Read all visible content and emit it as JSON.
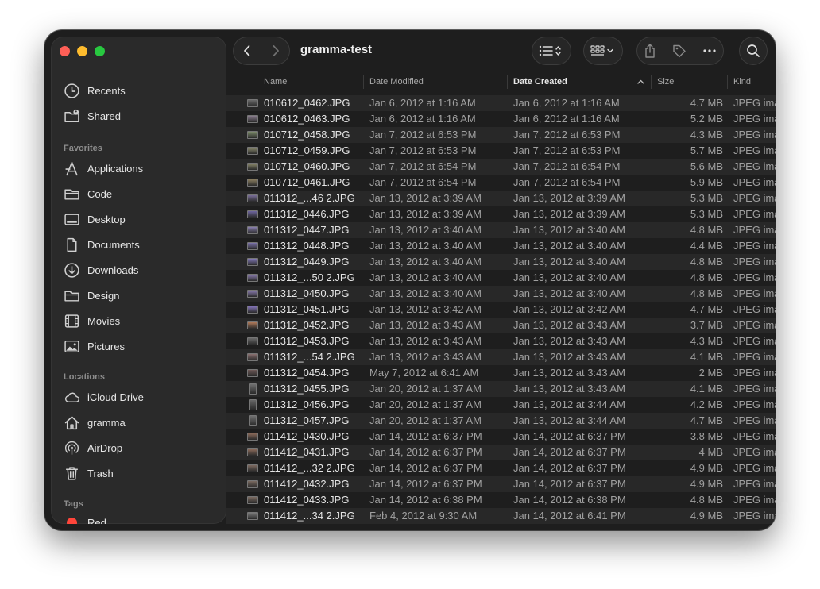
{
  "window": {
    "title": "gramma-test"
  },
  "sidebar": {
    "top_items": [
      {
        "label": "Recents",
        "icon": "clock-icon"
      },
      {
        "label": "Shared",
        "icon": "shared-folder-icon"
      }
    ],
    "favorites_header": "Favorites",
    "favorites": [
      {
        "label": "Applications",
        "icon": "applications-icon"
      },
      {
        "label": "Code",
        "icon": "folder-icon"
      },
      {
        "label": "Desktop",
        "icon": "desktop-icon"
      },
      {
        "label": "Documents",
        "icon": "document-icon"
      },
      {
        "label": "Downloads",
        "icon": "download-icon"
      },
      {
        "label": "Design",
        "icon": "folder-icon"
      },
      {
        "label": "Movies",
        "icon": "film-icon"
      },
      {
        "label": "Pictures",
        "icon": "photo-icon"
      }
    ],
    "locations_header": "Locations",
    "locations": [
      {
        "label": "iCloud Drive",
        "icon": "cloud-icon"
      },
      {
        "label": "gramma",
        "icon": "home-icon"
      },
      {
        "label": "AirDrop",
        "icon": "airdrop-icon"
      },
      {
        "label": "Trash",
        "icon": "trash-icon"
      }
    ],
    "tags_header": "Tags",
    "tags": [
      {
        "label": "Red",
        "color": "#ff453a"
      }
    ]
  },
  "columns": {
    "name": "Name",
    "date_modified": "Date Modified",
    "date_created": "Date Created",
    "size": "Size",
    "kind": "Kind",
    "sorted_by": "Date Created",
    "sort_direction": "ascending"
  },
  "files": [
    {
      "name": "010612_0462.JPG",
      "modified": "Jan 6, 2012 at 1:16 AM",
      "created": "Jan 6, 2012 at 1:16 AM",
      "size": "4.7 MB",
      "kind": "JPEG image"
    },
    {
      "name": "010612_0463.JPG",
      "modified": "Jan 6, 2012 at 1:16 AM",
      "created": "Jan 6, 2012 at 1:16 AM",
      "size": "5.2 MB",
      "kind": "JPEG image"
    },
    {
      "name": "010712_0458.JPG",
      "modified": "Jan 7, 2012 at 6:53 PM",
      "created": "Jan 7, 2012 at 6:53 PM",
      "size": "4.3 MB",
      "kind": "JPEG image"
    },
    {
      "name": "010712_0459.JPG",
      "modified": "Jan 7, 2012 at 6:53 PM",
      "created": "Jan 7, 2012 at 6:53 PM",
      "size": "5.7 MB",
      "kind": "JPEG image"
    },
    {
      "name": "010712_0460.JPG",
      "modified": "Jan 7, 2012 at 6:54 PM",
      "created": "Jan 7, 2012 at 6:54 PM",
      "size": "5.6 MB",
      "kind": "JPEG image"
    },
    {
      "name": "010712_0461.JPG",
      "modified": "Jan 7, 2012 at 6:54 PM",
      "created": "Jan 7, 2012 at 6:54 PM",
      "size": "5.9 MB",
      "kind": "JPEG image"
    },
    {
      "name": "011312_...46 2.JPG",
      "modified": "Jan 13, 2012 at 3:39 AM",
      "created": "Jan 13, 2012 at 3:39 AM",
      "size": "5.3 MB",
      "kind": "JPEG image"
    },
    {
      "name": "011312_0446.JPG",
      "modified": "Jan 13, 2012 at 3:39 AM",
      "created": "Jan 13, 2012 at 3:39 AM",
      "size": "5.3 MB",
      "kind": "JPEG image"
    },
    {
      "name": "011312_0447.JPG",
      "modified": "Jan 13, 2012 at 3:40 AM",
      "created": "Jan 13, 2012 at 3:40 AM",
      "size": "4.8 MB",
      "kind": "JPEG image"
    },
    {
      "name": "011312_0448.JPG",
      "modified": "Jan 13, 2012 at 3:40 AM",
      "created": "Jan 13, 2012 at 3:40 AM",
      "size": "4.4 MB",
      "kind": "JPEG image"
    },
    {
      "name": "011312_0449.JPG",
      "modified": "Jan 13, 2012 at 3:40 AM",
      "created": "Jan 13, 2012 at 3:40 AM",
      "size": "4.8 MB",
      "kind": "JPEG image"
    },
    {
      "name": "011312_...50 2.JPG",
      "modified": "Jan 13, 2012 at 3:40 AM",
      "created": "Jan 13, 2012 at 3:40 AM",
      "size": "4.8 MB",
      "kind": "JPEG image"
    },
    {
      "name": "011312_0450.JPG",
      "modified": "Jan 13, 2012 at 3:40 AM",
      "created": "Jan 13, 2012 at 3:40 AM",
      "size": "4.8 MB",
      "kind": "JPEG image"
    },
    {
      "name": "011312_0451.JPG",
      "modified": "Jan 13, 2012 at 3:42 AM",
      "created": "Jan 13, 2012 at 3:42 AM",
      "size": "4.7 MB",
      "kind": "JPEG image"
    },
    {
      "name": "011312_0452.JPG",
      "modified": "Jan 13, 2012 at 3:43 AM",
      "created": "Jan 13, 2012 at 3:43 AM",
      "size": "3.7 MB",
      "kind": "JPEG image"
    },
    {
      "name": "011312_0453.JPG",
      "modified": "Jan 13, 2012 at 3:43 AM",
      "created": "Jan 13, 2012 at 3:43 AM",
      "size": "4.3 MB",
      "kind": "JPEG image"
    },
    {
      "name": "011312_...54 2.JPG",
      "modified": "Jan 13, 2012 at 3:43 AM",
      "created": "Jan 13, 2012 at 3:43 AM",
      "size": "4.1 MB",
      "kind": "JPEG image"
    },
    {
      "name": "011312_0454.JPG",
      "modified": "May 7, 2012 at 6:41 AM",
      "created": "Jan 13, 2012 at 3:43 AM",
      "size": "2 MB",
      "kind": "JPEG image"
    },
    {
      "name": "011312_0455.JPG",
      "modified": "Jan 20, 2012 at 1:37 AM",
      "created": "Jan 13, 2012 at 3:43 AM",
      "size": "4.1 MB",
      "kind": "JPEG image",
      "portrait": true
    },
    {
      "name": "011312_0456.JPG",
      "modified": "Jan 20, 2012 at 1:37 AM",
      "created": "Jan 13, 2012 at 3:44 AM",
      "size": "4.2 MB",
      "kind": "JPEG image",
      "portrait": true
    },
    {
      "name": "011312_0457.JPG",
      "modified": "Jan 20, 2012 at 1:37 AM",
      "created": "Jan 13, 2012 at 3:44 AM",
      "size": "4.7 MB",
      "kind": "JPEG image",
      "portrait": true
    },
    {
      "name": "011412_0430.JPG",
      "modified": "Jan 14, 2012 at 6:37 PM",
      "created": "Jan 14, 2012 at 6:37 PM",
      "size": "3.8 MB",
      "kind": "JPEG image"
    },
    {
      "name": "011412_0431.JPG",
      "modified": "Jan 14, 2012 at 6:37 PM",
      "created": "Jan 14, 2012 at 6:37 PM",
      "size": "4 MB",
      "kind": "JPEG image"
    },
    {
      "name": "011412_...32 2.JPG",
      "modified": "Jan 14, 2012 at 6:37 PM",
      "created": "Jan 14, 2012 at 6:37 PM",
      "size": "4.9 MB",
      "kind": "JPEG image"
    },
    {
      "name": "011412_0432.JPG",
      "modified": "Jan 14, 2012 at 6:37 PM",
      "created": "Jan 14, 2012 at 6:37 PM",
      "size": "4.9 MB",
      "kind": "JPEG image"
    },
    {
      "name": "011412_0433.JPG",
      "modified": "Jan 14, 2012 at 6:38 PM",
      "created": "Jan 14, 2012 at 6:38 PM",
      "size": "4.8 MB",
      "kind": "JPEG image"
    },
    {
      "name": "011412_...34 2.JPG",
      "modified": "Feb 4, 2012 at 9:30 AM",
      "created": "Jan 14, 2012 at 6:41 PM",
      "size": "4.9 MB",
      "kind": "JPEG image"
    }
  ],
  "thumb_colors": [
    "#6a6a6a",
    "#8a7d8f",
    "#7c8a6a",
    "#8a8a6e",
    "#8c8a6b",
    "#8a7e60",
    "#7a6f9a",
    "#6f66a0",
    "#8a80b0",
    "#7d74ad",
    "#8178b6",
    "#8a7cb0",
    "#8a7cb0",
    "#8475b8",
    "#b07a5a",
    "#6a6a6a",
    "#8a7070",
    "#6f5a58",
    "#707070",
    "#686868",
    "#6f6f6f",
    "#8a6a5a",
    "#8a6a5a",
    "#7d6a60",
    "#7a6a60",
    "#7a6a60",
    "#7a7a7a"
  ]
}
